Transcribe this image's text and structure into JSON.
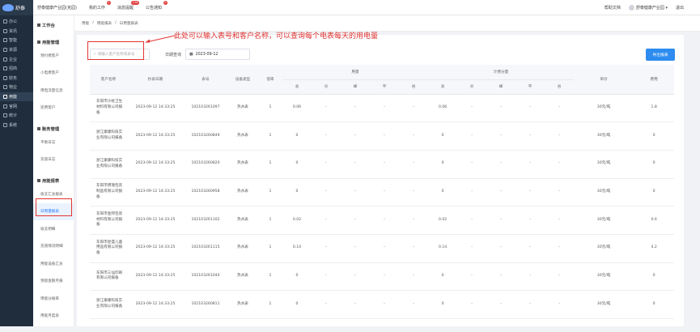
{
  "rail": [
    {
      "label": "办公"
    },
    {
      "label": "资讯"
    },
    {
      "label": "智能"
    },
    {
      "label": "资源"
    },
    {
      "label": "企业"
    },
    {
      "label": "招商"
    },
    {
      "label": "财务"
    },
    {
      "label": "物业"
    },
    {
      "label": "用能",
      "active": true
    },
    {
      "label": "官网"
    },
    {
      "label": "统计"
    },
    {
      "label": "系统"
    }
  ],
  "logo": {
    "text": "舒泰"
  },
  "topbar": {
    "tabs": [
      {
        "label": "舒泰健康产业园(克园)"
      },
      {
        "label": "我的工作",
        "badge": "0"
      },
      {
        "label": "消息提醒",
        "badge": "116"
      },
      {
        "label": "公告通知",
        "badge": "0"
      }
    ],
    "help": "帮助文档",
    "user": "舒泰健康产业园",
    "logout": "退出"
  },
  "menu": [
    {
      "group": "工作台",
      "items": []
    },
    {
      "group": "用能管理",
      "items": [
        {
          "label": "预付费客户"
        },
        {
          "label": "小电费客户"
        },
        {
          "label": "用电流量信息"
        },
        {
          "label": "逆费客户"
        }
      ]
    },
    {
      "group": "账务管理",
      "items": [
        {
          "label": "平衡日志"
        },
        {
          "label": "充值日志"
        }
      ]
    },
    {
      "group": "用能报表",
      "items": [
        {
          "label": "收支汇总报表"
        },
        {
          "label": "日用量报表",
          "active": true
        },
        {
          "label": "收支明细"
        },
        {
          "label": "充值情况明细"
        },
        {
          "label": "用能设备汇总"
        },
        {
          "label": "预留金额月报"
        },
        {
          "label": "用能分摊率"
        },
        {
          "label": "用能月度表"
        }
      ]
    }
  ],
  "breadcrumbs": [
    "用能",
    "用能报表",
    "日用量报表"
  ],
  "filter": {
    "placeholder": "请输入客户名称或表号",
    "date_label": "日期查询",
    "date_value": "2023-09-12",
    "export": "导出报表"
  },
  "annotation": "此处可以输入表号和客户名称，可以查询每个电表每天的用电量",
  "table": {
    "head_top": {
      "cust": "客户名称",
      "time": "抄表日期",
      "meter": "表号",
      "type": "设备类型",
      "ratio": "倍率",
      "usage": "用量",
      "billing": "计费分量",
      "price": "单价",
      "amount": "费用"
    },
    "sub": [
      "总",
      "尖",
      "峰",
      "平",
      "谷",
      "总",
      "尖",
      "峰",
      "平",
      "谷"
    ],
    "rows": [
      {
        "cust": "东阳市沙枕卫生材料有限公司报备",
        "time": "2023-09-12 14:33:25",
        "meter": "102103261097",
        "type": "热水表",
        "ratio": "1",
        "u": [
          "0.06",
          "-",
          "-",
          "-",
          "-"
        ],
        "b": [
          "0.06",
          "-",
          "-",
          "-",
          "-"
        ],
        "price": "30元/吨",
        "amount": "1.8"
      },
      {
        "cust": "浙江康康科技实业有限公司报备",
        "time": "2023-09-12 14:33:25",
        "meter": "102103260849",
        "type": "热水表",
        "ratio": "1",
        "u": [
          "0",
          "-",
          "-",
          "-",
          "-"
        ],
        "b": [
          "0",
          "-",
          "-",
          "-",
          "-"
        ],
        "price": "30元/吨",
        "amount": "0"
      },
      {
        "cust": "浙江康康科技实业有限公司报备",
        "time": "2023-09-12 14:33:25",
        "meter": "102103260820",
        "type": "热水表",
        "ratio": "1",
        "u": [
          "0",
          "-",
          "-",
          "-",
          "-"
        ],
        "b": [
          "0",
          "-",
          "-",
          "-",
          "-"
        ],
        "price": "30元/吨",
        "amount": "0"
      },
      {
        "cust": "东阳市明瑞包装制品有限公司报备",
        "time": "2023-09-12 14:33:25",
        "meter": "102103260958",
        "type": "热水表",
        "ratio": "1",
        "u": [
          "0",
          "-",
          "-",
          "-",
          "-"
        ],
        "b": [
          "0",
          "-",
          "-",
          "-",
          "-"
        ],
        "price": "30元/吨",
        "amount": "0"
      },
      {
        "cust": "东阳市金邦包装材料有限公司报备",
        "time": "2023-09-12 14:33:25",
        "meter": "102103261102",
        "type": "热水表",
        "ratio": "1",
        "u": [
          "0.02",
          "-",
          "-",
          "-",
          "-"
        ],
        "b": [
          "0.02",
          "-",
          "-",
          "-",
          "-"
        ],
        "price": "30元/吨",
        "amount": "0.6"
      },
      {
        "cust": "东阳市星盛儿童用品有限公司报备",
        "time": "2023-09-12 14:33:25",
        "meter": "102103261115",
        "type": "热水表",
        "ratio": "1",
        "u": [
          "0.14",
          "-",
          "-",
          "-",
          "-"
        ],
        "b": [
          "0.14",
          "-",
          "-",
          "-",
          "-"
        ],
        "price": "30元/吨",
        "amount": "4.2"
      },
      {
        "cust": "东阳市三仙印刷有限公司报备",
        "time": "2023-09-12 14:33:25",
        "meter": "102103261040",
        "type": "热水表",
        "ratio": "1",
        "u": [
          "0",
          "-",
          "-",
          "-",
          "-"
        ],
        "b": [
          "0",
          "-",
          "-",
          "-",
          "-"
        ],
        "price": "30元/吨",
        "amount": "0"
      },
      {
        "cust": "浙江康康科技实业有限公司报备",
        "time": "2023-09-12 14:33:25",
        "meter": "102103260811",
        "type": "热水表",
        "ratio": "1",
        "u": [
          "0",
          "-",
          "-",
          "-",
          "-"
        ],
        "b": [
          "0",
          "-",
          "-",
          "-",
          "-"
        ],
        "price": "30元/吨",
        "amount": "0"
      }
    ]
  }
}
